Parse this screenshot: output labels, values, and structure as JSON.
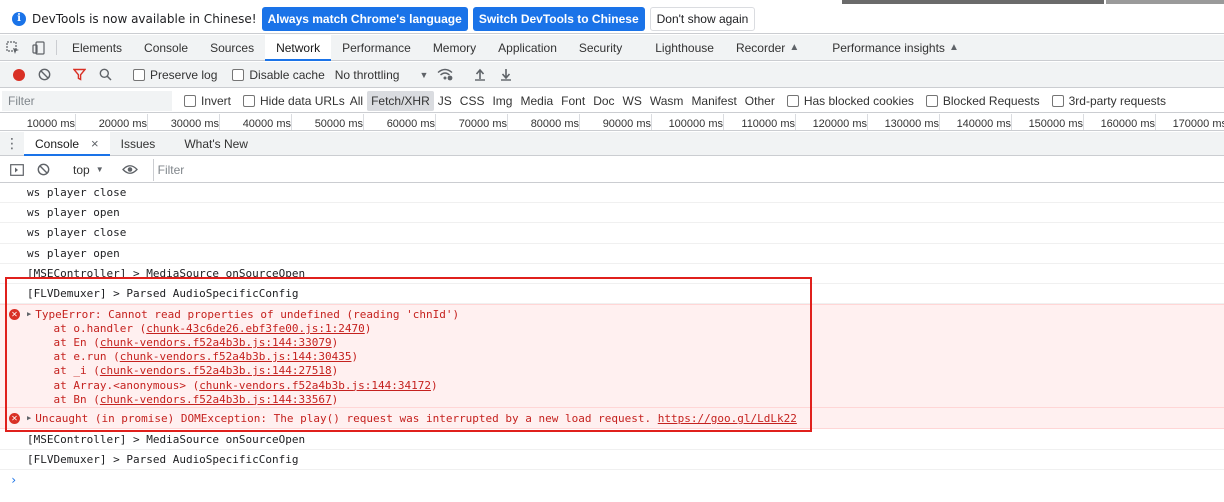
{
  "infobar": {
    "icon": "info-icon",
    "message": "DevTools is now available in Chinese!",
    "btn_match": "Always match Chrome's language",
    "btn_switch": "Switch DevTools to Chinese",
    "btn_dont_show": "Don't show again"
  },
  "tabs": [
    {
      "label": "Elements"
    },
    {
      "label": "Console"
    },
    {
      "label": "Sources"
    },
    {
      "label": "Network",
      "active": true
    },
    {
      "label": "Performance"
    },
    {
      "label": "Memory"
    },
    {
      "label": "Application"
    },
    {
      "label": "Security"
    },
    {
      "label": "Lighthouse"
    },
    {
      "label": "Recorder"
    },
    {
      "label": "Performance insights"
    }
  ],
  "network_toolbar": {
    "preserve_log": "Preserve log",
    "disable_cache": "Disable cache",
    "throttling": "No throttling"
  },
  "filterbar": {
    "placeholder": "Filter",
    "invert": "Invert",
    "hide_data_urls": "Hide data URLs",
    "types": [
      "All",
      "Fetch/XHR",
      "JS",
      "CSS",
      "Img",
      "Media",
      "Font",
      "Doc",
      "WS",
      "Wasm",
      "Manifest",
      "Other"
    ],
    "selected_type": "Fetch/XHR",
    "has_blocked_cookies": "Has blocked cookies",
    "blocked_requests": "Blocked Requests",
    "third_party": "3rd-party requests"
  },
  "timeline": {
    "ticks": [
      "10000 ms",
      "20000 ms",
      "30000 ms",
      "40000 ms",
      "50000 ms",
      "60000 ms",
      "70000 ms",
      "80000 ms",
      "90000 ms",
      "100000 ms",
      "110000 ms",
      "120000 ms",
      "130000 ms",
      "140000 ms",
      "150000 ms",
      "160000 ms",
      "170000 ms"
    ]
  },
  "drawer": {
    "tabs": [
      "Console",
      "Issues",
      "What's New"
    ],
    "active": "Console"
  },
  "console_toolbar": {
    "context": "top",
    "filter_placeholder": "Filter"
  },
  "console": {
    "messages_before": [
      "ws player close",
      "ws player open",
      "ws player close",
      "ws player open",
      "[MSEController] > MediaSource onSourceOpen",
      "[FLVDemuxer] > Parsed AudioSpecificConfig"
    ],
    "error1": {
      "title": "TypeError: Cannot read properties of undefined (reading 'chnId')",
      "stack": [
        {
          "prefix": "    at o.handler (",
          "link": "chunk-43c6de26.ebf3fe00.js:1:2470",
          "suffix": ")"
        },
        {
          "prefix": "    at En (",
          "link": "chunk-vendors.f52a4b3b.js:144:33079",
          "suffix": ")"
        },
        {
          "prefix": "    at e.run (",
          "link": "chunk-vendors.f52a4b3b.js:144:30435",
          "suffix": ")"
        },
        {
          "prefix": "    at _i (",
          "link": "chunk-vendors.f52a4b3b.js:144:27518",
          "suffix": ")"
        },
        {
          "prefix": "    at Array.<anonymous> (",
          "link": "chunk-vendors.f52a4b3b.js:144:34172",
          "suffix": ")"
        },
        {
          "prefix": "    at Bn (",
          "link": "chunk-vendors.f52a4b3b.js:144:33567",
          "suffix": ")"
        }
      ]
    },
    "error2": {
      "text": "Uncaught (in promise) DOMException: The play() request was interrupted by a new load request. ",
      "link": "https://goo.gl/LdLk22"
    },
    "messages_after": [
      "[MSEController] > MediaSource onSourceOpen",
      "[FLVDemuxer] > Parsed AudioSpecificConfig"
    ],
    "prompt": "›"
  },
  "colors": {
    "accent": "#1a73e8",
    "error_text": "#c5221f",
    "error_bg": "#fff0f0",
    "highlight_box": "#e0201c",
    "record": "#d93025"
  }
}
